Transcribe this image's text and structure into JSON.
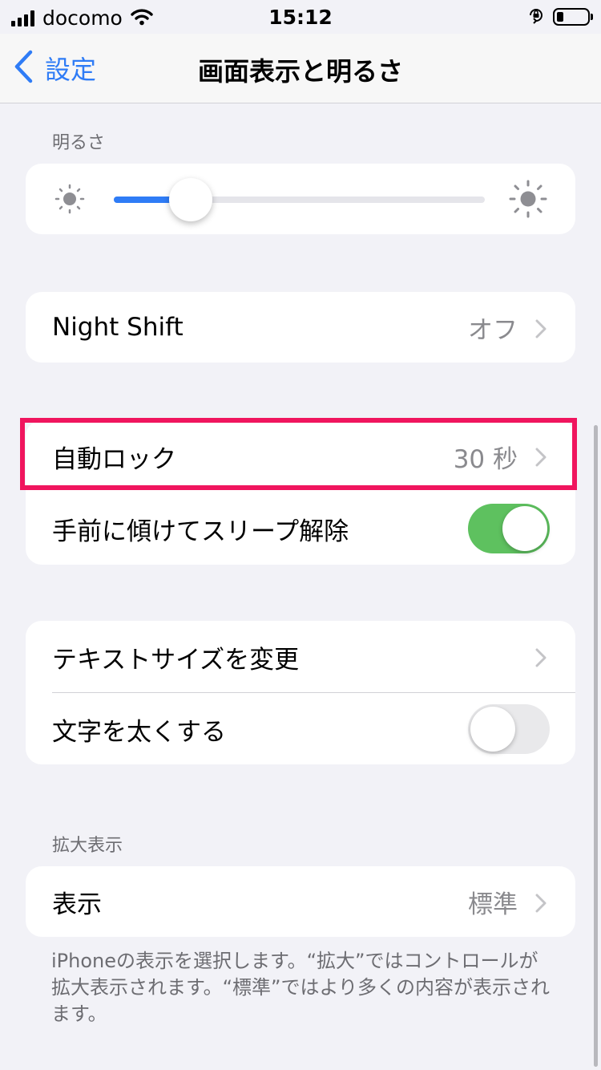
{
  "status_bar": {
    "carrier": "docomo",
    "time": "15:12",
    "icons": [
      "signal-icon",
      "wifi-icon",
      "orientation-lock-icon",
      "battery-icon"
    ]
  },
  "navbar": {
    "back_label": "設定",
    "title": "画面表示と明るさ"
  },
  "brightness": {
    "header": "明るさ",
    "level": 0.12
  },
  "night_shift": {
    "label": "Night Shift",
    "value": "オフ"
  },
  "lock_group": {
    "auto_lock_label": "自動ロック",
    "auto_lock_value": "30 秒",
    "raise_to_wake_label": "手前に傾けてスリープ解除",
    "raise_to_wake_on": true
  },
  "text_group": {
    "text_size_label": "テキストサイズを変更",
    "bold_text_label": "文字を太くする",
    "bold_text_on": false
  },
  "zoom": {
    "header": "拡大表示",
    "display_label": "表示",
    "display_value": "標準",
    "footer": "iPhoneの表示を選択します。“拡大”ではコントロールが拡大表示されます。“標準”ではより多くの内容が表示されます。"
  },
  "colors": {
    "accent": "#2f7cf6",
    "toggle_on": "#5ec15f",
    "highlight": "#f0155e"
  }
}
